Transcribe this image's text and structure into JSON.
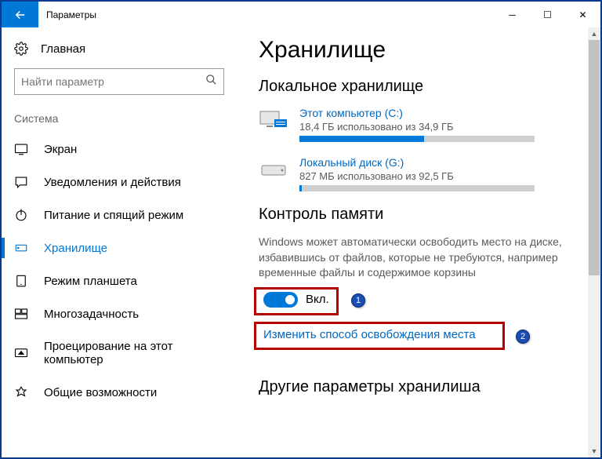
{
  "window": {
    "title": "Параметры"
  },
  "sidebar": {
    "home": "Главная",
    "search_placeholder": "Найти параметр",
    "section": "Система",
    "items": [
      {
        "label": "Экран"
      },
      {
        "label": "Уведомления и действия"
      },
      {
        "label": "Питание и спящий режим"
      },
      {
        "label": "Хранилище"
      },
      {
        "label": "Режим планшета"
      },
      {
        "label": "Многозадачность"
      },
      {
        "label": "Проецирование на этот компьютер"
      },
      {
        "label": "Общие возможности"
      }
    ],
    "active_index": 3
  },
  "main": {
    "title": "Хранилище",
    "local_heading": "Локальное хранилище",
    "drives": [
      {
        "name": "Этот компьютер (C:)",
        "usage": "18,4 ГБ использовано из 34,9 ГБ",
        "fill_pct": 53
      },
      {
        "name": "Локальный диск (G:)",
        "usage": "827 МБ использовано из 92,5 ГБ",
        "fill_pct": 1
      }
    ],
    "sense_heading": "Контроль памяти",
    "sense_desc": "Windows может автоматически освободить место на диске, избавившись от файлов, которые не требуются, например временные файлы и содержимое корзины",
    "toggle_label": "Вкл.",
    "change_link": "Изменить способ освобождения места",
    "other_heading": "Другие параметры хранилиша"
  },
  "annotations": {
    "badge1": "1",
    "badge2": "2"
  }
}
